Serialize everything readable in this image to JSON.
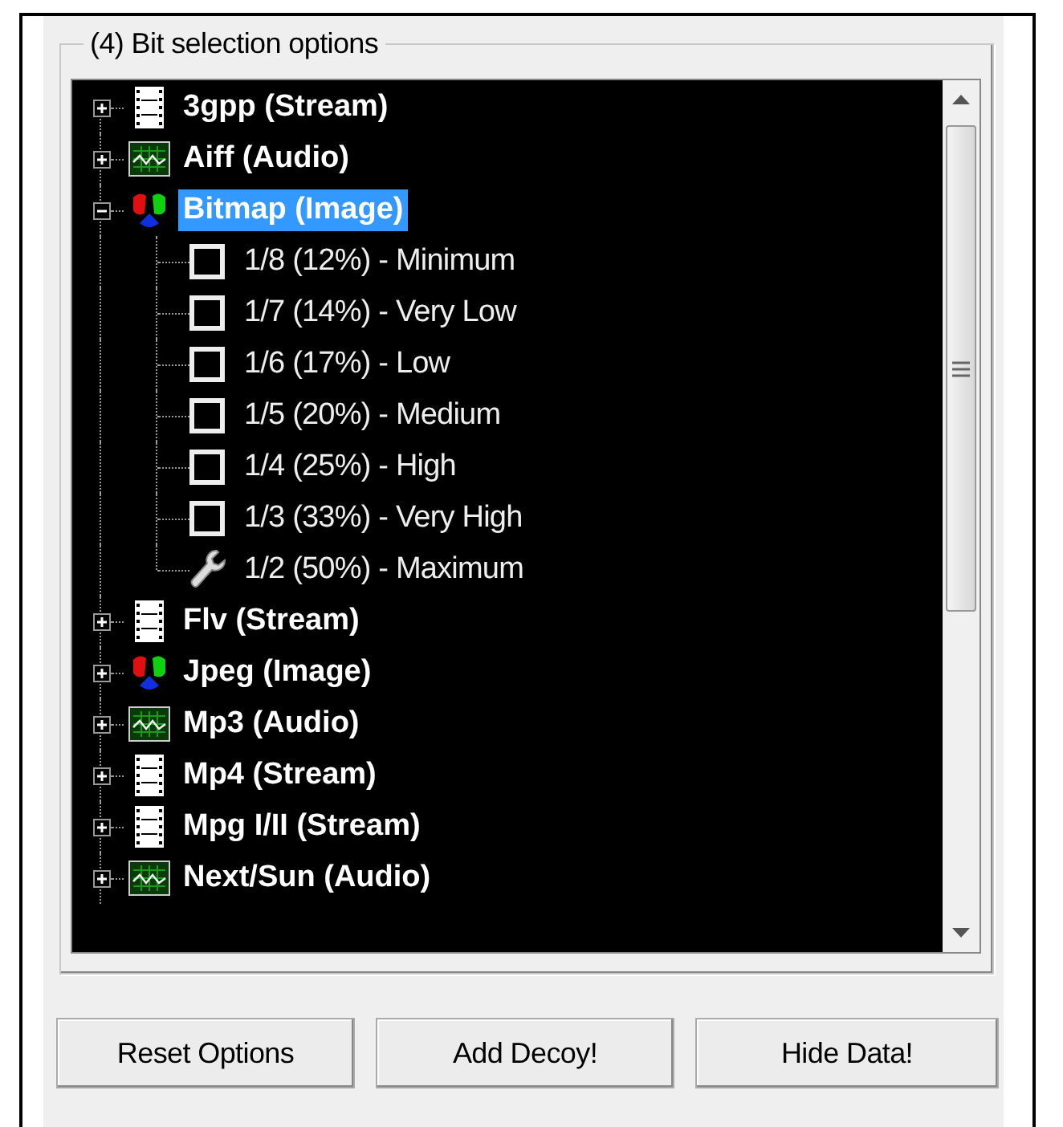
{
  "group": {
    "title": "(4)  Bit selection options"
  },
  "tree": {
    "items": [
      {
        "label": "3gpp (Stream)",
        "kind": "stream",
        "expanded": false,
        "selected": false
      },
      {
        "label": "Aiff (Audio)",
        "kind": "audio",
        "expanded": false,
        "selected": false
      },
      {
        "label": "Bitmap (Image)",
        "kind": "image",
        "expanded": true,
        "selected": true,
        "children": [
          {
            "label": "1/8 (12%) - Minimum",
            "kind": "checkbox",
            "checked": false
          },
          {
            "label": "1/7 (14%) - Very Low",
            "kind": "checkbox",
            "checked": false
          },
          {
            "label": "1/6 (17%) - Low",
            "kind": "checkbox",
            "checked": false
          },
          {
            "label": "1/5 (20%) - Medium",
            "kind": "checkbox",
            "checked": false
          },
          {
            "label": "1/4 (25%) - High",
            "kind": "checkbox",
            "checked": false
          },
          {
            "label": "1/3 (33%) - Very High",
            "kind": "checkbox",
            "checked": false
          },
          {
            "label": "1/2 (50%) - Maximum",
            "kind": "wrench"
          }
        ]
      },
      {
        "label": "Flv (Stream)",
        "kind": "stream",
        "expanded": false,
        "selected": false
      },
      {
        "label": "Jpeg (Image)",
        "kind": "image",
        "expanded": false,
        "selected": false
      },
      {
        "label": "Mp3 (Audio)",
        "kind": "audio",
        "expanded": false,
        "selected": false
      },
      {
        "label": "Mp4 (Stream)",
        "kind": "stream",
        "expanded": false,
        "selected": false
      },
      {
        "label": "Mpg I/II (Stream)",
        "kind": "stream",
        "expanded": false,
        "selected": false
      },
      {
        "label": "Next/Sun (Audio)",
        "kind": "audio",
        "expanded": false,
        "selected": false
      }
    ]
  },
  "buttons": [
    "Reset Options",
    "Add Decoy!",
    "Hide Data!"
  ]
}
